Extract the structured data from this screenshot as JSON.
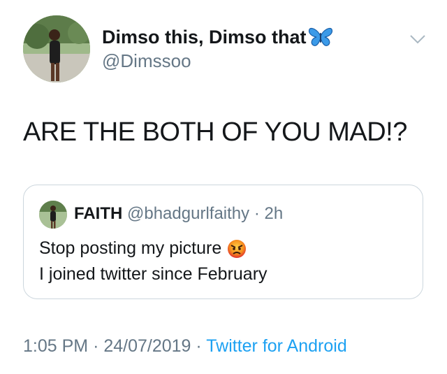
{
  "author": {
    "display_name": "Dimso this, Dimso that",
    "handle": "@Dimssoo",
    "avatar_icon": "profile-photo",
    "badge_icon": "butterfly-emoji"
  },
  "tweet": {
    "text": "ARE THE BOTH OF YOU MAD!?"
  },
  "quoted_tweet": {
    "name": "FAITH",
    "handle": "@bhadgurlfaithy",
    "separator": "·",
    "time": "2h",
    "line1": "Stop posting my picture",
    "line2": "I joined twitter since February",
    "emoji_icon": "angry-face-emoji"
  },
  "meta": {
    "time": "1:05 PM",
    "separator": "·",
    "date": "24/07/2019",
    "source": "Twitter for Android"
  },
  "colors": {
    "text": "#14171a",
    "secondary": "#657786",
    "link": "#1da1f2",
    "border": "#ccd6dd"
  }
}
